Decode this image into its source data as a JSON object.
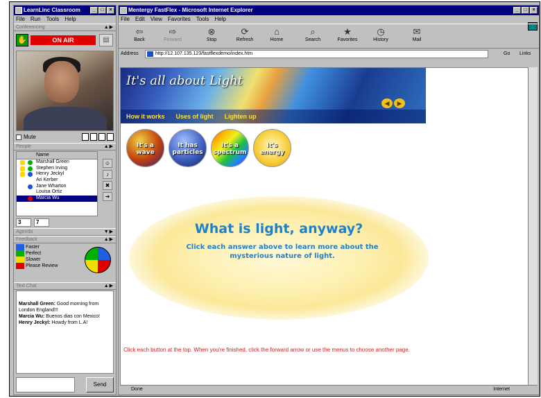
{
  "left_window": {
    "title": "LearnLinc Classroom",
    "menu": [
      "File",
      "Run",
      "Tools",
      "Help"
    ],
    "conferencing": {
      "header": "Conferencing",
      "on_air": "ON AIR"
    },
    "mute_label": "Mute",
    "people": {
      "header": "People",
      "column": "Name",
      "names": [
        "Marshall Green",
        "Stephen Irving",
        "Henry Jeckyl",
        "Ari Kerber",
        "Jane Wharton",
        "Louisa Ortiz",
        "Marcia Wu"
      ],
      "selected": "Marcia Wu",
      "count_a": "3",
      "count_b": "7"
    },
    "agenda": {
      "header": "Agenda"
    },
    "feedback": {
      "header": "Feedback",
      "items": [
        "Faster",
        "Perfect",
        "Slower",
        "Please Review"
      ],
      "colors": [
        "#2060e0",
        "#00b000",
        "#f0e000",
        "#e00000"
      ]
    },
    "text_chat": {
      "header": "Text Chat",
      "messages": [
        {
          "name": "Marshall Green:",
          "text": " Good morning from London England!!!"
        },
        {
          "name": "Marcia Wu:",
          "text": " Buenos dias con Mexico!"
        },
        {
          "name": "Henry Jeckyl:",
          "text": " Howdy from L.A!"
        }
      ],
      "send": "Send"
    }
  },
  "ie_window": {
    "title": "Mentergy FastFlex - Microsoft Internet Explorer",
    "menu": [
      "File",
      "Edit",
      "View",
      "Favorites",
      "Tools",
      "Help"
    ],
    "toolbar": [
      "Back",
      "Forward",
      "Stop",
      "Refresh",
      "Home",
      "Search",
      "Favorites",
      "History",
      "Mail"
    ],
    "address_label": "Address",
    "address": "http://12.107.135.123/fastflexdemo/index.htm",
    "go": "Go",
    "links": "Links",
    "status_left": "Done",
    "status_right": "Internet"
  },
  "page": {
    "banner_title": "It's all about Light",
    "nav": [
      "How it works",
      "Uses of light",
      "Lighten up"
    ],
    "circles": [
      "It's a wave",
      "It has particles",
      "It's a spectrum",
      "It's energy"
    ],
    "question_title": "What is light, anyway?",
    "question_sub": "Click each answer above to learn more about the mysterious nature of light.",
    "instructions": "Click each button at the top. When you're finished, click the forward arrow or use the menus to choose another page."
  }
}
